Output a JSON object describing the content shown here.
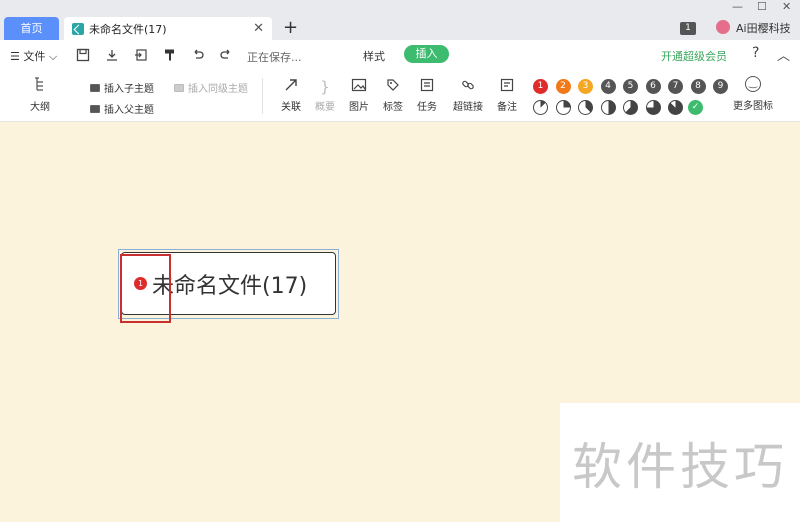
{
  "tabs": {
    "home_label": "首页",
    "doc_label": "未命名文件(17)",
    "close_glyph": "✕",
    "add_glyph": "+"
  },
  "window": {
    "minimize": "—",
    "maximize": "☐",
    "close": "✕",
    "page_count": "1",
    "user_name": "Ai田樱科技"
  },
  "menu": {
    "file_label": "☰ 文件 ⌵",
    "saving_text": "正在保存...",
    "style_tab": "样式",
    "insert_tab": "插入",
    "vip_link": "开通超级会员",
    "help": "?",
    "collapse": "︿"
  },
  "tools": {
    "outline": "大纲",
    "insert_child": "插入子主题",
    "insert_sibling": "插入同级主题",
    "insert_parent": "插入父主题",
    "relation": "关联",
    "summary": "概要",
    "image": "图片",
    "tag": "标签",
    "task": "任务",
    "hyperlink": "超链接",
    "note": "备注",
    "more_icons": "更多图标"
  },
  "priority_badges": [
    {
      "label": "1",
      "color": "#e02b2b"
    },
    {
      "label": "2",
      "color": "#f07a1a"
    },
    {
      "label": "3",
      "color": "#f5a623"
    },
    {
      "label": "4",
      "color": "#555555"
    },
    {
      "label": "5",
      "color": "#555555"
    },
    {
      "label": "6",
      "color": "#555555"
    },
    {
      "label": "7",
      "color": "#555555"
    },
    {
      "label": "8",
      "color": "#555555"
    },
    {
      "label": "9",
      "color": "#555555"
    }
  ],
  "progress_levels": [
    0.125,
    0.25,
    0.375,
    0.5,
    0.625,
    0.75,
    0.875
  ],
  "node": {
    "badge": "1",
    "text": "未命名文件(17)"
  },
  "watermark": "软件技巧"
}
